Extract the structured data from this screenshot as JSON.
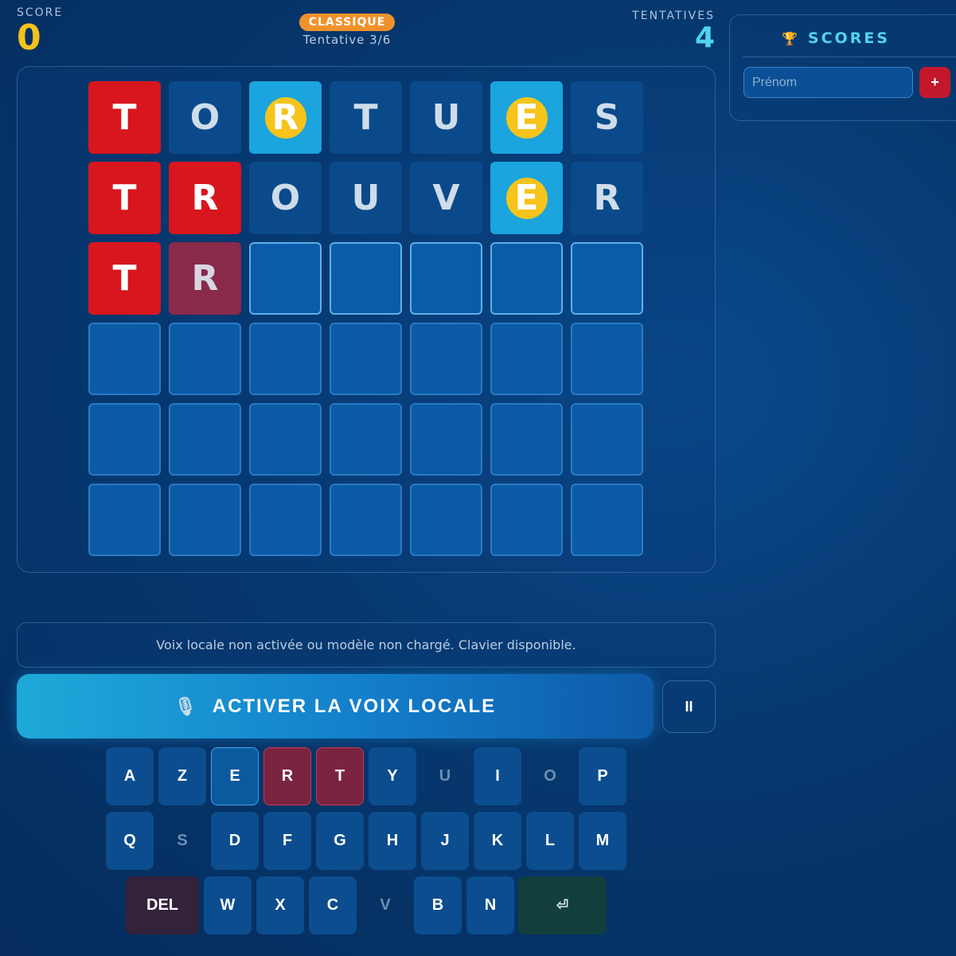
{
  "header": {
    "score_label": "SCORE",
    "score_value": "0",
    "mode_badge": "CLASSIQUE",
    "attempt_text": "Tentative 3/6",
    "tries_label": "TENTATIVES",
    "tries_value": "4"
  },
  "board": {
    "rows": [
      [
        {
          "letter": "T",
          "state": "correct"
        },
        {
          "letter": "O",
          "state": "absent"
        },
        {
          "letter": "R",
          "state": "misplaced"
        },
        {
          "letter": "T",
          "state": "absent"
        },
        {
          "letter": "U",
          "state": "absent"
        },
        {
          "letter": "E",
          "state": "misplaced"
        },
        {
          "letter": "S",
          "state": "absent"
        }
      ],
      [
        {
          "letter": "T",
          "state": "correct"
        },
        {
          "letter": "R",
          "state": "correct"
        },
        {
          "letter": "O",
          "state": "absent"
        },
        {
          "letter": "U",
          "state": "absent"
        },
        {
          "letter": "V",
          "state": "absent"
        },
        {
          "letter": "E",
          "state": "misplaced"
        },
        {
          "letter": "R",
          "state": "absent"
        }
      ],
      [
        {
          "letter": "T",
          "state": "correct"
        },
        {
          "letter": "R",
          "state": "pending"
        },
        {
          "letter": "",
          "state": "active"
        },
        {
          "letter": "",
          "state": "active"
        },
        {
          "letter": "",
          "state": "active"
        },
        {
          "letter": "",
          "state": "active"
        },
        {
          "letter": "",
          "state": "active"
        }
      ],
      [
        {
          "letter": "",
          "state": "empty"
        },
        {
          "letter": "",
          "state": "empty"
        },
        {
          "letter": "",
          "state": "empty"
        },
        {
          "letter": "",
          "state": "empty"
        },
        {
          "letter": "",
          "state": "empty"
        },
        {
          "letter": "",
          "state": "empty"
        },
        {
          "letter": "",
          "state": "empty"
        }
      ],
      [
        {
          "letter": "",
          "state": "empty"
        },
        {
          "letter": "",
          "state": "empty"
        },
        {
          "letter": "",
          "state": "empty"
        },
        {
          "letter": "",
          "state": "empty"
        },
        {
          "letter": "",
          "state": "empty"
        },
        {
          "letter": "",
          "state": "empty"
        },
        {
          "letter": "",
          "state": "empty"
        }
      ],
      [
        {
          "letter": "",
          "state": "empty"
        },
        {
          "letter": "",
          "state": "empty"
        },
        {
          "letter": "",
          "state": "empty"
        },
        {
          "letter": "",
          "state": "empty"
        },
        {
          "letter": "",
          "state": "empty"
        },
        {
          "letter": "",
          "state": "empty"
        },
        {
          "letter": "",
          "state": "empty"
        }
      ]
    ]
  },
  "scores": {
    "icon": "trophy-icon",
    "title": "SCORES",
    "name_placeholder": "Prénom",
    "add_label": "+"
  },
  "status": {
    "message": "Voix locale non activée ou modèle non chargé. Clavier disponible."
  },
  "voice": {
    "icon": "microphone-icon",
    "button_label": "ACTIVER LA VOIX LOCALE",
    "pause_label": "II"
  },
  "keyboard": {
    "rows": [
      [
        {
          "label": "A",
          "state": "normal"
        },
        {
          "label": "Z",
          "state": "normal"
        },
        {
          "label": "E",
          "state": "hint"
        },
        {
          "label": "R",
          "state": "found"
        },
        {
          "label": "T",
          "state": "found"
        },
        {
          "label": "Y",
          "state": "normal"
        },
        {
          "label": "U",
          "state": "used"
        },
        {
          "label": "I",
          "state": "normal"
        },
        {
          "label": "O",
          "state": "used"
        },
        {
          "label": "P",
          "state": "normal"
        }
      ],
      [
        {
          "label": "Q",
          "state": "normal"
        },
        {
          "label": "S",
          "state": "used"
        },
        {
          "label": "D",
          "state": "normal"
        },
        {
          "label": "F",
          "state": "normal"
        },
        {
          "label": "G",
          "state": "normal"
        },
        {
          "label": "H",
          "state": "normal"
        },
        {
          "label": "J",
          "state": "normal"
        },
        {
          "label": "K",
          "state": "normal"
        },
        {
          "label": "L",
          "state": "normal"
        },
        {
          "label": "M",
          "state": "normal"
        }
      ],
      [
        {
          "label": "DEL",
          "state": "del"
        },
        {
          "label": "W",
          "state": "normal"
        },
        {
          "label": "X",
          "state": "normal"
        },
        {
          "label": "C",
          "state": "normal"
        },
        {
          "label": "V",
          "state": "used"
        },
        {
          "label": "B",
          "state": "normal"
        },
        {
          "label": "N",
          "state": "normal"
        },
        {
          "label": "⏎",
          "state": "enter"
        }
      ]
    ]
  },
  "colors": {
    "correct": "#d8161e",
    "misplaced": "#1ba4dd",
    "misplaced_ring": "#f6c41a",
    "score": "#f4c21b",
    "accent": "#4fd4f0",
    "badge": "#f0922b"
  }
}
